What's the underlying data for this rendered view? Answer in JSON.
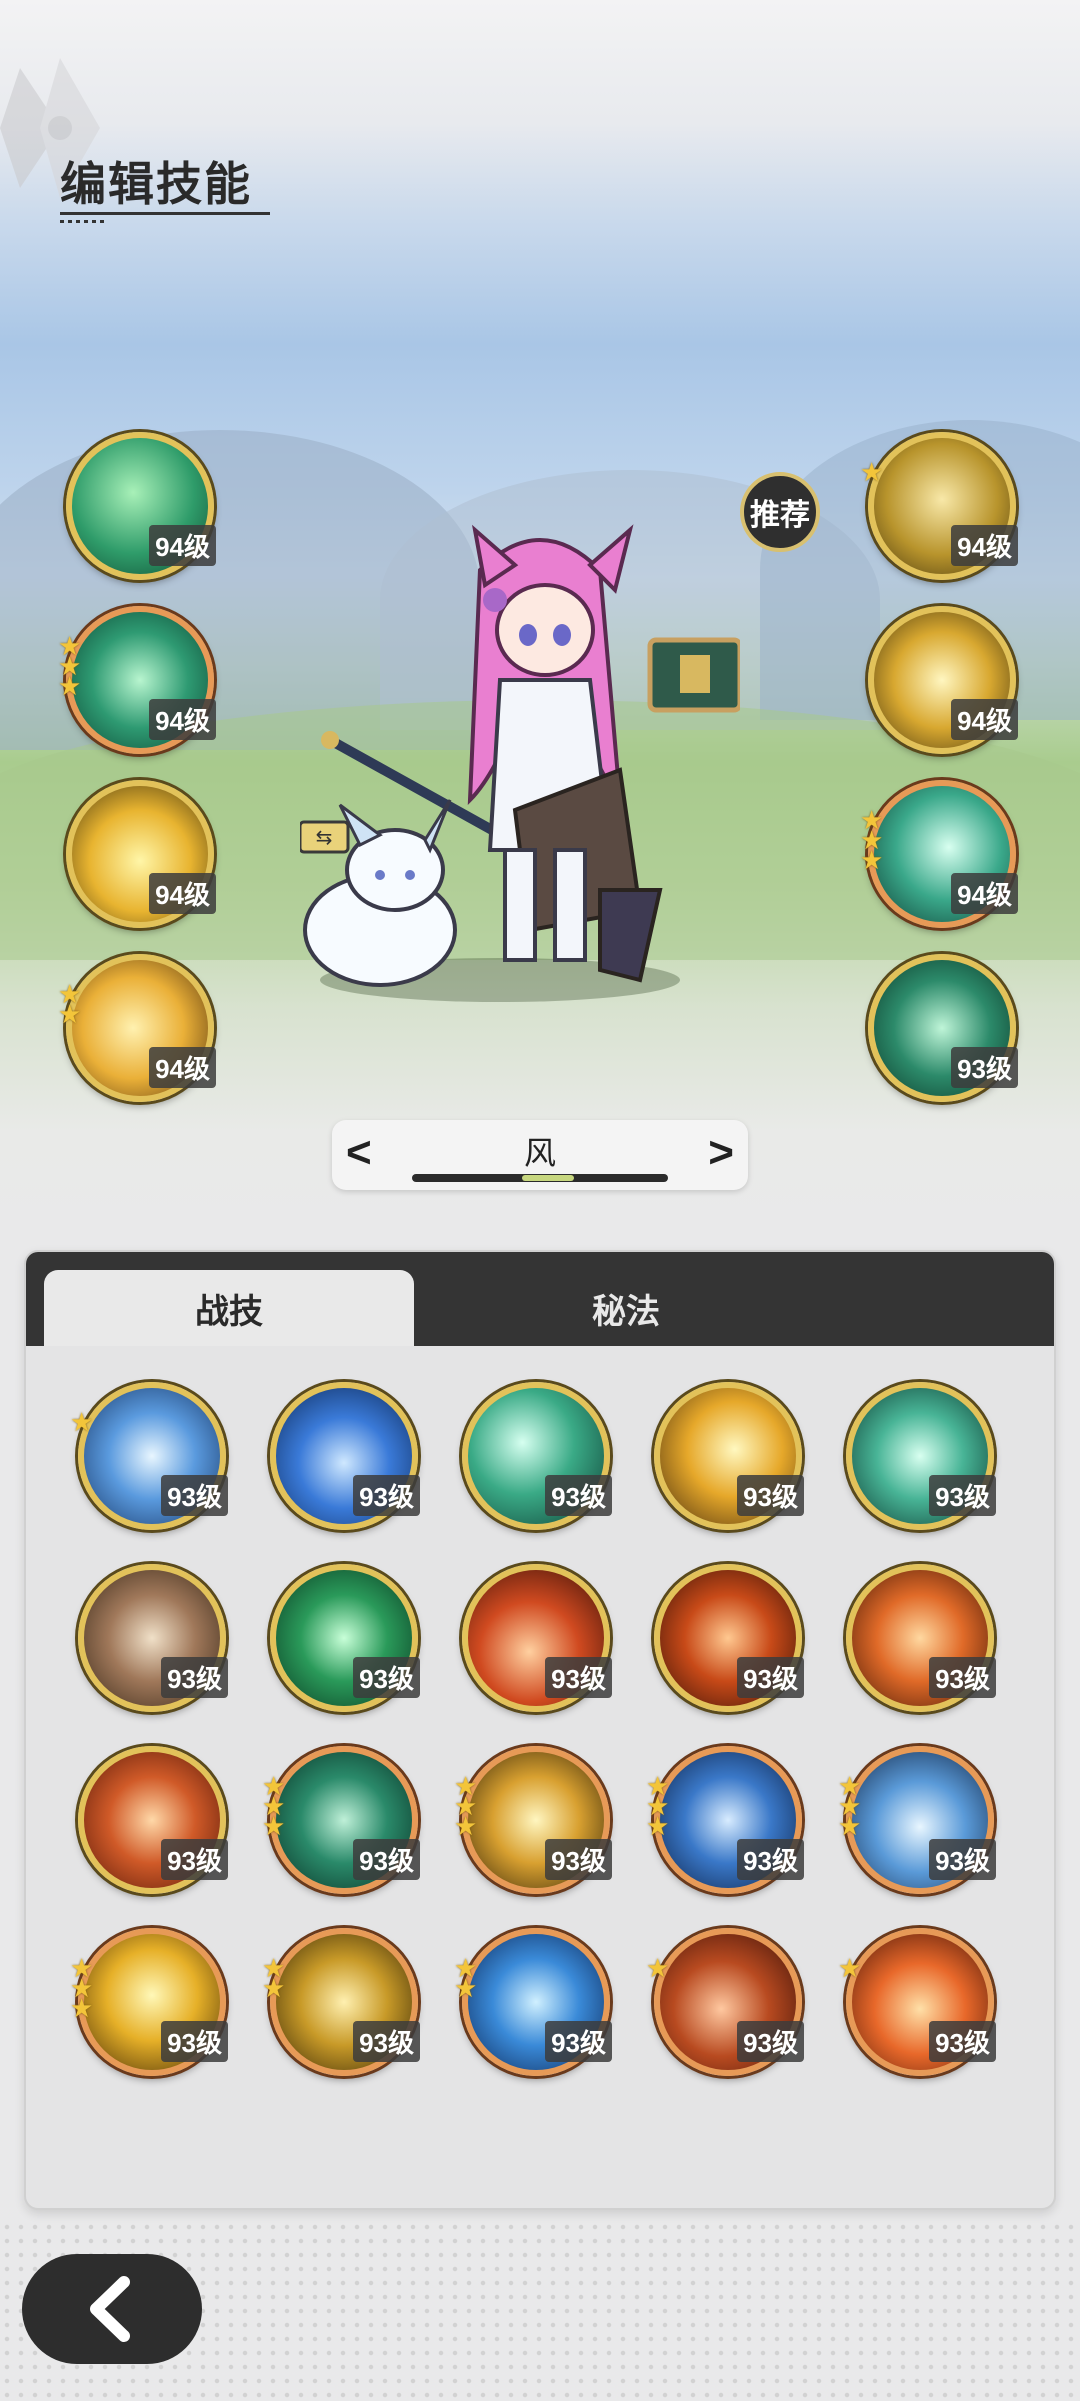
{
  "header": {
    "title": "编辑技能"
  },
  "colors": {
    "gold_frame": "#e2c25a",
    "orange_frame": "#e79a57",
    "tab_bar": "#343434",
    "star": "#f3c53a"
  },
  "recommend_badge": "推荐",
  "element_selector": {
    "current": "风",
    "prev": "<",
    "next": ">"
  },
  "left_skills": [
    {
      "level": "94级",
      "icon": "green-wind-icon",
      "stars": 0
    },
    {
      "level": "94级",
      "icon": "green-orb-icon",
      "stars": 3
    },
    {
      "level": "94级",
      "icon": "yellow-light-fox-icon",
      "stars": 0
    },
    {
      "level": "94级",
      "icon": "golden-spear-icon",
      "stars": 2
    }
  ],
  "right_skills": [
    {
      "level": "94级",
      "icon": "gold-silhouette-icon",
      "stars": 1
    },
    {
      "level": "94级",
      "icon": "gold-burst-icon",
      "stars": 0
    },
    {
      "level": "94级",
      "icon": "green-wave-icon",
      "stars": 3
    },
    {
      "level": "93级",
      "icon": "green-leaf-icon",
      "stars": 0
    }
  ],
  "tabs": [
    {
      "label": "战技",
      "active": true
    },
    {
      "label": "秘法",
      "active": false
    }
  ],
  "grid_skills": [
    {
      "level": "93级",
      "icon": "ice-shatter-icon",
      "stars": 1,
      "frame": "gold"
    },
    {
      "level": "93级",
      "icon": "water-flame-icon",
      "stars": 0,
      "frame": "gold"
    },
    {
      "level": "93级",
      "icon": "wind-slash-icon",
      "stars": 0,
      "frame": "gold"
    },
    {
      "level": "93级",
      "icon": "light-burst-icon",
      "stars": 0,
      "frame": "gold"
    },
    {
      "level": "93级",
      "icon": "wind-vortex-icon",
      "stars": 0,
      "frame": "gold"
    },
    {
      "level": "93级",
      "icon": "rock-shield-icon",
      "stars": 0,
      "frame": "gold"
    },
    {
      "level": "93级",
      "icon": "heal-cross-icon",
      "stars": 0,
      "frame": "gold"
    },
    {
      "level": "93级",
      "icon": "fire-flare-icon",
      "stars": 0,
      "frame": "gold"
    },
    {
      "level": "93级",
      "icon": "fire-swirl-icon",
      "stars": 0,
      "frame": "gold"
    },
    {
      "level": "93级",
      "icon": "fire-wave-icon",
      "stars": 0,
      "frame": "gold"
    },
    {
      "level": "93级",
      "icon": "fire-orb-icon",
      "stars": 0,
      "frame": "gold"
    },
    {
      "level": "93级",
      "icon": "thorn-vine-icon",
      "stars": 3,
      "frame": "orange"
    },
    {
      "level": "93级",
      "icon": "lightning-icon",
      "stars": 3,
      "frame": "orange"
    },
    {
      "level": "93级",
      "icon": "ice-crystal-icon",
      "stars": 3,
      "frame": "orange"
    },
    {
      "level": "93级",
      "icon": "ice-spike-icon",
      "stars": 3,
      "frame": "orange"
    },
    {
      "level": "93级",
      "icon": "sun-orb-icon",
      "stars": 3,
      "frame": "orange"
    },
    {
      "level": "93级",
      "icon": "gold-crystal-icon",
      "stars": 2,
      "frame": "orange"
    },
    {
      "level": "93级",
      "icon": "water-vortex-icon",
      "stars": 2,
      "frame": "orange"
    },
    {
      "level": "93级",
      "icon": "meteor-icon",
      "stars": 1,
      "frame": "orange"
    },
    {
      "level": "93级",
      "icon": "fire-explosion-icon",
      "stars": 1,
      "frame": "orange"
    }
  ]
}
